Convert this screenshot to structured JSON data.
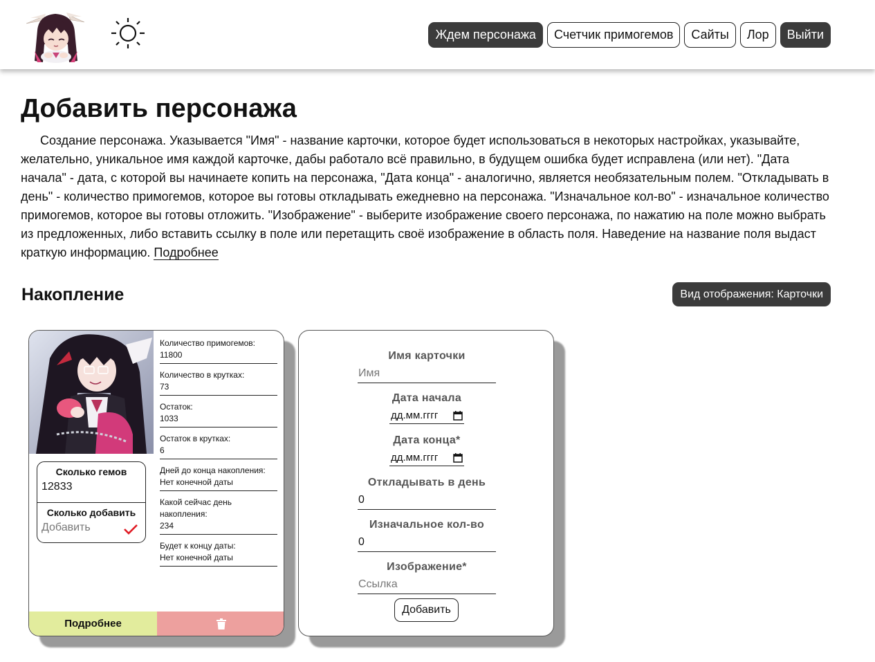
{
  "header": {
    "nav": {
      "waiting": "Ждем персонажа",
      "counter": "Счетчик примогемов",
      "sites": "Сайты",
      "lore": "Лор",
      "logout": "Выйти"
    }
  },
  "icons": {
    "logo": "chibi-character-logo",
    "theme": "sun-icon",
    "check": "check-icon",
    "delete": "trash-icon",
    "calendar": "calendar-icon"
  },
  "colors": {
    "dark_button": "#3b3b3b",
    "more_button": "#e2ec9d",
    "delete_button": "#eda09e",
    "check": "#e01b24"
  },
  "intro": {
    "title": "Добавить персонажа",
    "text": "Создание персонажа. Указывается \"Имя\" - название карточки, которое будет использоваться в некоторых настройках, указывайте, желательно, уникальное имя каждой карточке, дабы работало всё правильно, в будущем ошибка будет исправлена (или нет). \"Дата начала\" - дата, с которой вы начинаете копить на персонажа, \"Дата конца\" - аналогично, является необязательным полем. \"Откладывать в день\" - количество примогемов, которое вы готовы откладывать ежедневно на персонажа. \"Изначальное кол-во\" - изначальное количество примогемов, которое вы готовы отложить. \"Изображение\" - выберите изображение своего персонажа, по нажатию на поле можно выбрать из предложенных, либо вставить ссылку в поле или перетащить своё изображение в область поля. Наведение на название поля выдаст краткую информацию.",
    "more_link": "Подробнее"
  },
  "section": {
    "title": "Накопление",
    "view_toggle": "Вид отображения: Карточки"
  },
  "card": {
    "stats": [
      {
        "label": "Количество примогемов:",
        "value": "11800"
      },
      {
        "label": "Количество в крутках:",
        "value": "73"
      },
      {
        "label": "Остаток:",
        "value": "1033"
      },
      {
        "label": "Остаток в крутках:",
        "value": "6"
      },
      {
        "label": "Дней до конца накопления:",
        "value": "Нет конечной даты"
      },
      {
        "label": "Какой сейчас день накопления:",
        "value": "234"
      },
      {
        "label": "Будет к концу даты:",
        "value": "Нет конечной даты"
      }
    ],
    "gems_title": "Сколько гемов",
    "gems_value": "12833",
    "add_title": "Сколько добавить",
    "add_placeholder": "Добавить",
    "more_button": "Подробнее"
  },
  "form": {
    "name_label": "Имя карточки",
    "name_placeholder": "Имя",
    "start_label": "Дата начала",
    "start_value": "дд.мм.гггг",
    "end_label": "Дата конца*",
    "end_value": "дд.мм.гггг",
    "daily_label": "Откладывать в день",
    "daily_value": "0",
    "initial_label": "Изначальное кол-во",
    "initial_value": "0",
    "image_label": "Изображение*",
    "image_placeholder": "Ссылка",
    "submit": "Добавить"
  }
}
